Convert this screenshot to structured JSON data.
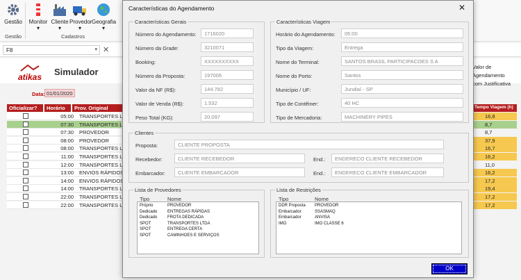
{
  "ribbon": {
    "buttons": [
      {
        "label": "Gestão",
        "icon": "gear-icon"
      },
      {
        "label": "Monitor",
        "icon": "monitor-icon"
      },
      {
        "label": "Cliente",
        "icon": "factory-icon"
      },
      {
        "label": "Provedor",
        "icon": "truck-icon"
      },
      {
        "label": "Geografia",
        "icon": "globe-icon"
      }
    ],
    "groups": [
      "Gestão",
      "Cadastros"
    ]
  },
  "cmdbar": {
    "combo_value": "F8"
  },
  "app": {
    "logo_text": "atikas",
    "title": "Simulador",
    "right_text_1": "Valor de Agendamento",
    "right_text_2": "com Justificativa"
  },
  "filter": {
    "date_label": "Data:",
    "date_value": "01/01/2020"
  },
  "grid": {
    "headers": [
      "Oficializar?",
      "Horário",
      "Prov. Original",
      "Tempo Viagem (h)"
    ],
    "rows": [
      {
        "time": "05:00",
        "provider": "TRANSPORTES LTDA",
        "viagem": "16,8"
      },
      {
        "time": "07:30",
        "provider": "TRANSPORTES LTDA",
        "viagem": "8,7"
      },
      {
        "time": "07:30",
        "provider": "PROVEDOR",
        "viagem": "8,7"
      },
      {
        "time": "08:00",
        "provider": "PROVEDOR",
        "viagem": "37,9"
      },
      {
        "time": "08:00",
        "provider": "TRANSPORTES LTDA",
        "viagem": "16,7"
      },
      {
        "time": "11:00",
        "provider": "TRANSPORTES LTDA",
        "viagem": "16,2"
      },
      {
        "time": "12:00",
        "provider": "TRANSPORTES LTDA",
        "viagem": "11,0"
      },
      {
        "time": "13:00",
        "provider": "ENVIOS RÁPIDOS",
        "viagem": "16,2"
      },
      {
        "time": "14:00",
        "provider": "ENVIOS RÁPIDOS",
        "viagem": "17,2"
      },
      {
        "time": "14:00",
        "provider": "TRANSPORTES LTDA",
        "viagem": "19,4"
      },
      {
        "time": "22:00",
        "provider": "TRANSPORTES LTDA",
        "viagem": "17,2"
      },
      {
        "time": "22:00",
        "provider": "TRANSPORTES LTDA",
        "viagem": "17,2"
      }
    ]
  },
  "dialog": {
    "title": "Características do Agendamento",
    "ok_label": "OK",
    "gerais": {
      "title": "Características Gerais",
      "fields": [
        {
          "label": "Número do Agendamento:",
          "value": "1716020"
        },
        {
          "label": "Número da Grade:",
          "value": "3210071"
        },
        {
          "label": "Booking:",
          "value": "XXXXXXXXXX"
        },
        {
          "label": "Número da Proposta:",
          "value": "197006"
        },
        {
          "label": "Valor da NF (R$):",
          "value": "144.782"
        },
        {
          "label": "Valor de Venda (R$):",
          "value": "1.532"
        },
        {
          "label": "Peso Total (KG):",
          "value": "20.097"
        }
      ]
    },
    "viagem": {
      "title": "Características Viagem",
      "fields": [
        {
          "label": "Horário do Agendamento:",
          "value": "05:00"
        },
        {
          "label": "Tipo da Viagem:",
          "value": "Entrega"
        },
        {
          "label": "Nome do Terminal:",
          "value": "SANTOS BRASIL PARTICIPACOES S A"
        },
        {
          "label": "Nome do Porto:",
          "value": "Santos"
        },
        {
          "label": "Município / UF:",
          "value": "Jundiaí - SP"
        },
        {
          "label": "Tipo de Contêiner:",
          "value": "40 HC"
        },
        {
          "label": "Tipo de Mercadoria:",
          "value": "MACHINERY PIPES"
        }
      ]
    },
    "clientes": {
      "title": "Clientes",
      "proposta_label": "Proposta:",
      "proposta_value": "CLIENTE PROPOSTA",
      "recebedor_label": "Recebedor:",
      "recebedor_value": "CLIENTE RECEBEDOR",
      "recebedor_end_label": "End.:",
      "recebedor_end_value": "ENDERECO CLIENTE RECEBEDOR",
      "embarcador_label": "Embarcador:",
      "embarcador_value": "CLIENTE EMBARCADOR",
      "embarcador_end_label": "End.:",
      "embarcador_end_value": "ENDERECO CLIENTE EMBARCADOR"
    },
    "provedores": {
      "title": "Lista de Provedores",
      "col1": "Tipo",
      "col2": "Nome",
      "rows": [
        {
          "tipo": "Próprio",
          "nome": "PROVEDOR"
        },
        {
          "tipo": "Dedicado",
          "nome": "ENTREGAS RÁPIDAS"
        },
        {
          "tipo": "Dedicado",
          "nome": "FROTA DEDICADA"
        },
        {
          "tipo": "SPOT",
          "nome": "TRANSPORTES LTDA"
        },
        {
          "tipo": "SPOT",
          "nome": "ENTREGA CERTA"
        },
        {
          "tipo": "SPOT",
          "nome": "CAMINHOES E SERVIÇOS"
        }
      ]
    },
    "restricoes": {
      "title": "Lista de Restrições",
      "col1": "Tipo",
      "col2": "Nome",
      "rows": [
        {
          "tipo": "DDR Proposta",
          "nome": "PROVEDOR"
        },
        {
          "tipo": "Embarcador",
          "nome": "SSASMAQ"
        },
        {
          "tipo": "Embarcador",
          "nome": "ANVISA"
        },
        {
          "tipo": "IMO",
          "nome": "IMO CLASSE 6"
        }
      ]
    }
  },
  "colors": {
    "brand_red": "#b51e1e",
    "ok_blue": "#0000c8",
    "yellow": "#f6c84f",
    "green": "#a8d08d"
  }
}
